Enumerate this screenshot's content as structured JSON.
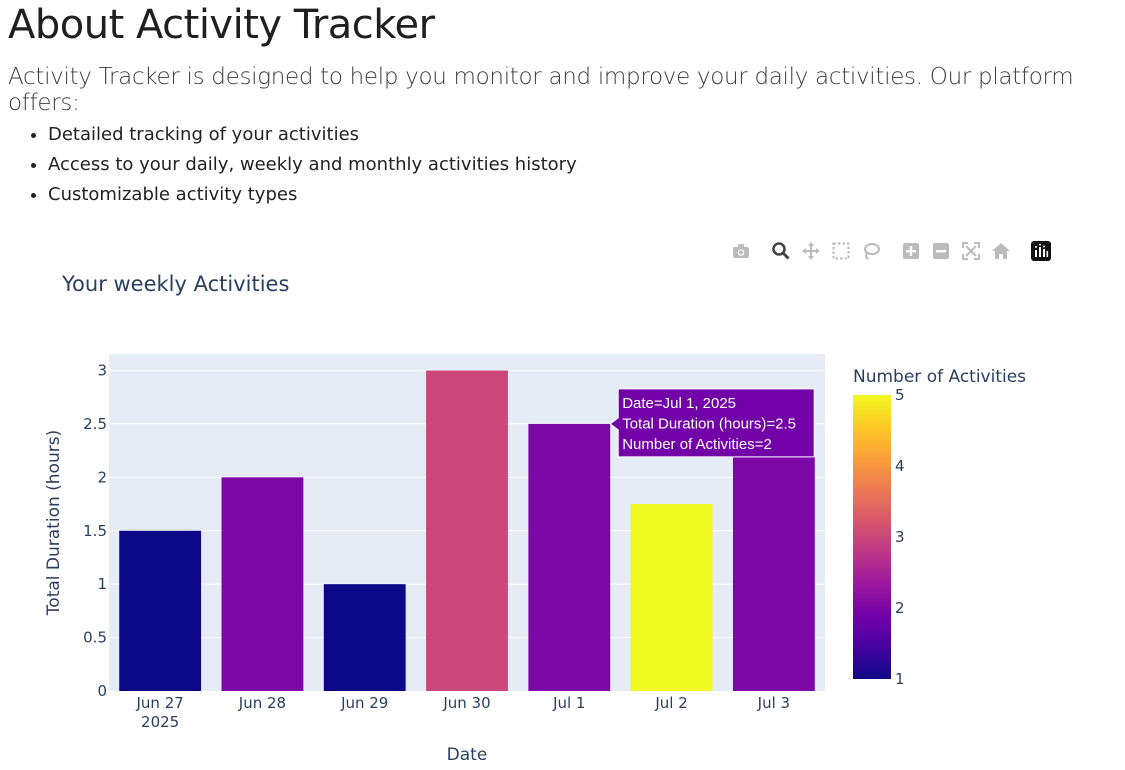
{
  "page": {
    "title": "About Activity Tracker",
    "intro": "Activity Tracker is designed to help you monitor and improve your daily activities. Our platform offers:",
    "features": [
      "Detailed tracking of your activities",
      "Access to your daily, weekly and monthly activities history",
      "Customizable activity types"
    ]
  },
  "modebar": {
    "buttons": [
      {
        "name": "camera-icon"
      },
      {
        "name": "zoom-icon"
      },
      {
        "name": "pan-icon"
      },
      {
        "name": "box-select-icon"
      },
      {
        "name": "lasso-select-icon"
      },
      {
        "name": "zoom-in-icon"
      },
      {
        "name": "zoom-out-icon"
      },
      {
        "name": "autoscale-icon"
      },
      {
        "name": "reset-axes-icon"
      },
      {
        "name": "plotly-logo-icon"
      }
    ]
  },
  "chart_data": {
    "type": "bar",
    "title": "Your weekly Activities",
    "xlabel": "Date",
    "ylabel": "Total Duration (hours)",
    "categories": [
      "Jun 27\n2025",
      "Jun 28",
      "Jun 29",
      "Jun 30",
      "Jul 1",
      "Jul 2",
      "Jul 3"
    ],
    "values": [
      1.5,
      2,
      1,
      3,
      2.5,
      1.75,
      2.2
    ],
    "color_values": [
      1,
      2,
      1,
      3,
      2,
      5,
      2
    ],
    "ylim": [
      0,
      3.2
    ],
    "y_ticks": [
      "0",
      "0.5",
      "1",
      "1.5",
      "2",
      "2.5",
      "3"
    ],
    "colorbar": {
      "title": "Number of Activities",
      "range": [
        1,
        5
      ],
      "ticks": [
        "1",
        "2",
        "3",
        "4",
        "5"
      ],
      "colors": [
        "#0d0887",
        "#46039f",
        "#7201a8",
        "#9c179e",
        "#bd3786",
        "#d8576b",
        "#ed7953",
        "#fb9f3a",
        "#fdca26",
        "#f0f921"
      ]
    },
    "plot_bgcolor": "#e5ecf6",
    "tooltip": {
      "bar_index": 4,
      "lines": [
        "Date=Jul 1, 2025",
        "Total Duration (hours)=2.5",
        "Number of Activities=2"
      ],
      "color": "#7201a8"
    }
  }
}
